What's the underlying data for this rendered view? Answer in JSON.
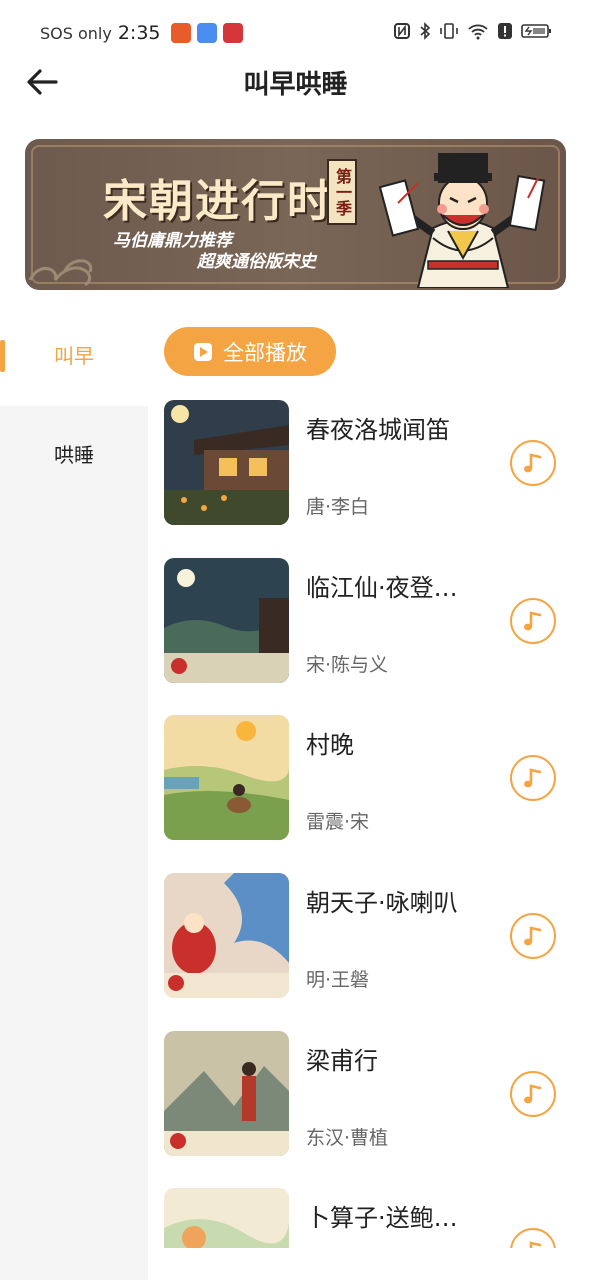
{
  "status_bar": {
    "carrier": "SOS only",
    "time": "2:35"
  },
  "header": {
    "title": "叫早哄睡",
    "back_icon": "arrow-left-icon"
  },
  "banner": {
    "title": "宋朝进行时",
    "season": "第一季",
    "subtitle_1": "马伯庸鼎力推荐",
    "subtitle_2": "超爽通俗版宋史"
  },
  "sidebar": {
    "items": [
      {
        "label": "叫早",
        "active": true
      },
      {
        "label": "哄睡",
        "active": false
      }
    ]
  },
  "play_all": {
    "label": "全部播放",
    "icon": "play-icon"
  },
  "list": {
    "items": [
      {
        "title": "春夜洛城闻笛",
        "author": "唐·李白"
      },
      {
        "title": "临江仙·夜登…",
        "author": "宋·陈与义"
      },
      {
        "title": "村晚",
        "author": "雷震·宋"
      },
      {
        "title": "朝天子·咏喇叭",
        "author": "明·王磐"
      },
      {
        "title": "梁甫行",
        "author": "东汉·曹植"
      },
      {
        "title": "卜算子·送鲍…",
        "author": ""
      }
    ]
  },
  "colors": {
    "accent": "#f5a443",
    "sidebar_bg": "#f5f5f5"
  }
}
